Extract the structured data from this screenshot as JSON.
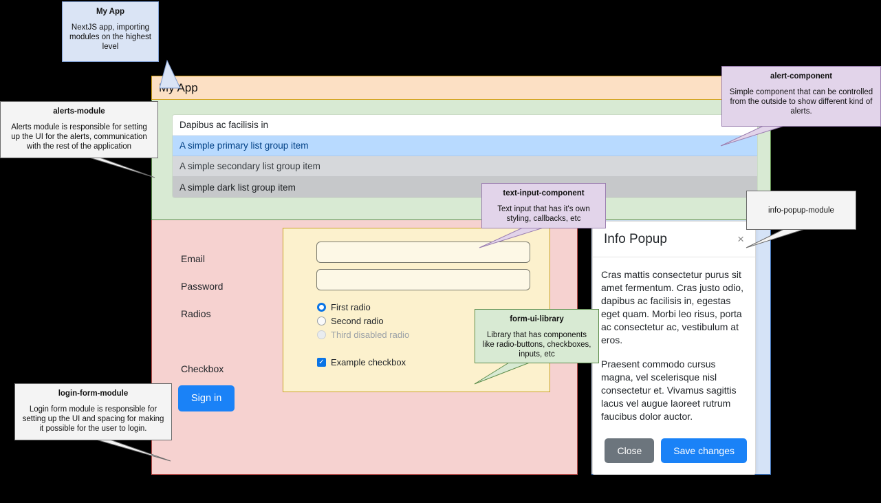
{
  "app": {
    "title": "My App",
    "header_alert_icon": "alert-pill"
  },
  "alerts_module": {
    "list_items": [
      {
        "text": "Dapibus ac facilisis in",
        "variant": "default"
      },
      {
        "text": "A simple primary list group item",
        "variant": "primary"
      },
      {
        "text": "A simple secondary list group item",
        "variant": "secondary"
      },
      {
        "text": "A simple dark list group item",
        "variant": "dark"
      }
    ]
  },
  "login_form": {
    "labels": {
      "email": "Email",
      "password": "Password",
      "radios": "Radios",
      "checkbox": "Checkbox"
    },
    "email_value": "",
    "email_placeholder": "",
    "password_value": "",
    "password_placeholder": "",
    "radios": [
      {
        "label": "First radio",
        "state": "checked"
      },
      {
        "label": "Second radio",
        "state": "unchecked"
      },
      {
        "label": "Third disabled radio",
        "state": "disabled"
      }
    ],
    "checkbox": {
      "label": "Example checkbox",
      "state": "checked",
      "glyph": "✓"
    },
    "signin_label": "Sign in"
  },
  "info_popup": {
    "title": "Info Popup",
    "close_icon": "×",
    "paragraph_1": "Cras mattis consectetur purus sit amet fermentum. Cras justo odio, dapibus ac facilisis in, egestas eget quam. Morbi leo risus, porta ac consectetur ac, vestibulum at eros.",
    "paragraph_2": "Praesent commodo cursus magna, vel scelerisque nisl consectetur et. Vivamus sagittis lacus vel augue laoreet rutrum faucibus dolor auctor.",
    "close_label": "Close",
    "save_label": "Save changes"
  },
  "callouts": {
    "my_app": {
      "title": "My App",
      "body": "NextJS app, importing modules on the highest level"
    },
    "alerts_module": {
      "title": "alerts-module",
      "body": "Alerts module is responsible for setting up the UI for the alerts, communication with the rest of the application"
    },
    "alert_component": {
      "title": "alert-component",
      "body": "Simple component that can be controlled from the outside to show different kind of alerts."
    },
    "text_input_component": {
      "title": "text-input-component",
      "body": "Text input that has it's own styling, callbacks, etc"
    },
    "form_ui_library": {
      "title": "form-ui-library",
      "body": "Library that has components like radio-buttons, checkboxes, inputs, etc"
    },
    "login_form_module": {
      "title": "login-form-module",
      "body": "Login form module is responsible for setting up the UI and spacing for making it possible for the user to login."
    },
    "info_popup_module": {
      "title": "info-popup-module"
    }
  },
  "colors": {
    "header_bg": "#fce0c4",
    "header_border": "#d4a017",
    "alerts_bg": "#d8ead3",
    "alerts_border": "#5b8c4a",
    "login_bg": "#f6d2d0",
    "login_border": "#c0504d",
    "formui_bg": "#fcf1cd",
    "formui_border": "#c9a227",
    "infopopup_bg": "#d5e3f7",
    "infopopup_border": "#3b6fb6",
    "primary": "#1a82f7",
    "secondary": "#6c757d"
  }
}
